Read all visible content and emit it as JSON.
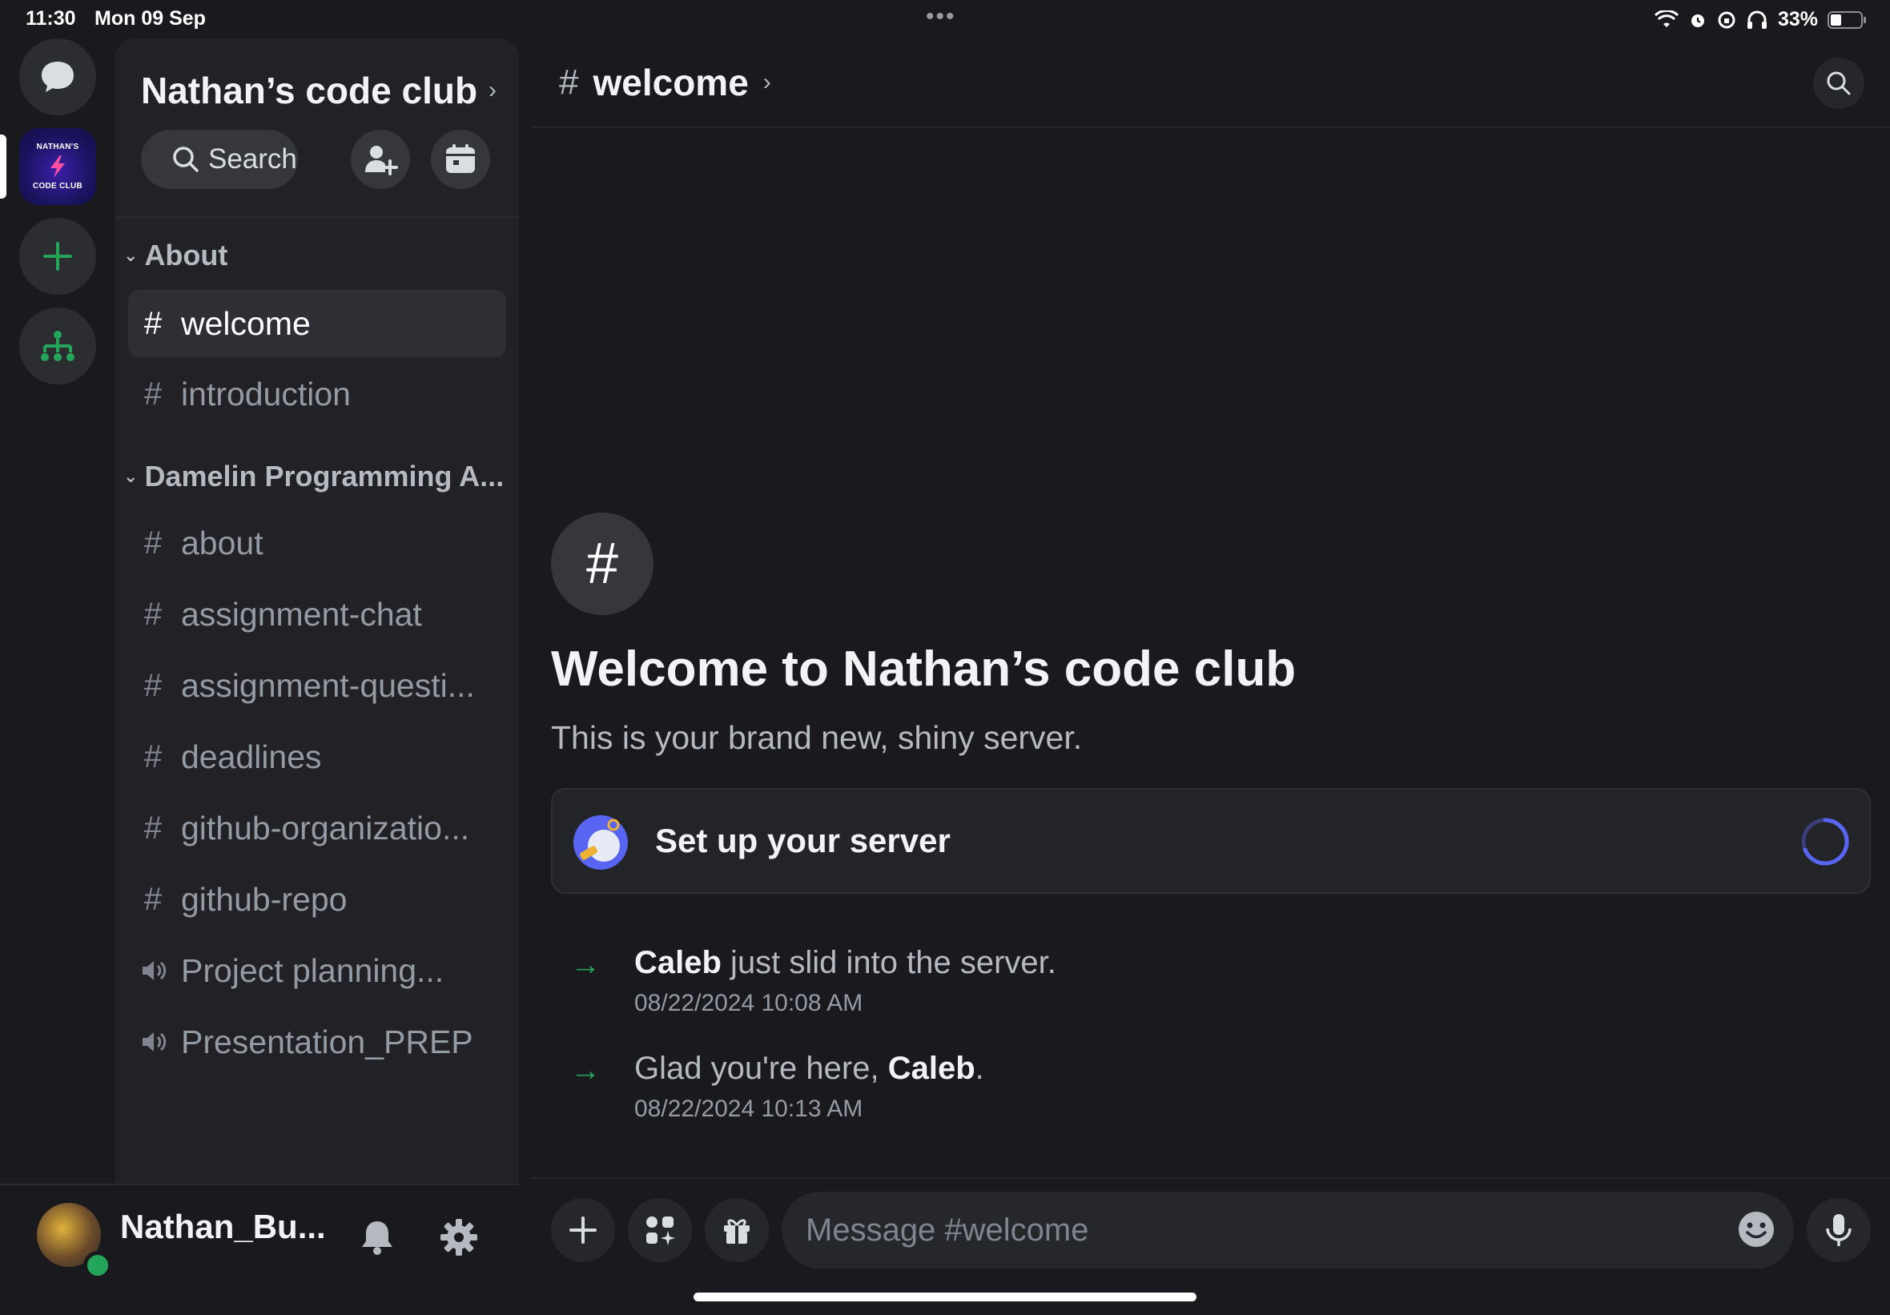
{
  "status_bar": {
    "time": "11:30",
    "date": "Mon 09 Sep",
    "battery": "33%",
    "menu_dots": "•••"
  },
  "server": {
    "name": "Nathan’s code club",
    "logo_line1": "NATHAN'S",
    "logo_line2": "CODE CLUB"
  },
  "toolbar": {
    "search_label": "Search"
  },
  "categories": [
    {
      "name": "About",
      "channels": [
        {
          "name": "welcome",
          "type": "text",
          "active": true
        },
        {
          "name": "introduction",
          "type": "text"
        }
      ]
    },
    {
      "name": "Damelin Programming A...",
      "channels": [
        {
          "name": "about",
          "type": "text"
        },
        {
          "name": "assignment-chat",
          "type": "text"
        },
        {
          "name": "assignment-questi...",
          "type": "text"
        },
        {
          "name": "deadlines",
          "type": "text"
        },
        {
          "name": "github-organizatio...",
          "type": "text"
        },
        {
          "name": "github-repo",
          "type": "text"
        },
        {
          "name": "Project planning...",
          "type": "voice"
        },
        {
          "name": "Presentation_PREP",
          "type": "voice"
        }
      ]
    }
  ],
  "user": {
    "name": "Nathan_Bu..."
  },
  "header": {
    "channel": "welcome",
    "hash": "#"
  },
  "welcome": {
    "title": "Welcome to Nathan’s code club",
    "subtitle": "This is your brand new, shiny server.",
    "setup_label": "Set up your server"
  },
  "messages": [
    {
      "prefix": "",
      "user": "Caleb",
      "suffix": " just slid into the server.",
      "time": "08/22/2024 10:08 AM"
    },
    {
      "prefix": "Glad you're here, ",
      "user": "Caleb",
      "suffix": ".",
      "time": "08/22/2024 10:13 AM"
    }
  ],
  "composer": {
    "placeholder": "Message #welcome"
  },
  "colors": {
    "background": "#1a1a1e",
    "panel": "#222226",
    "accent_green": "#23a55a",
    "spinner": "#5865f2"
  }
}
